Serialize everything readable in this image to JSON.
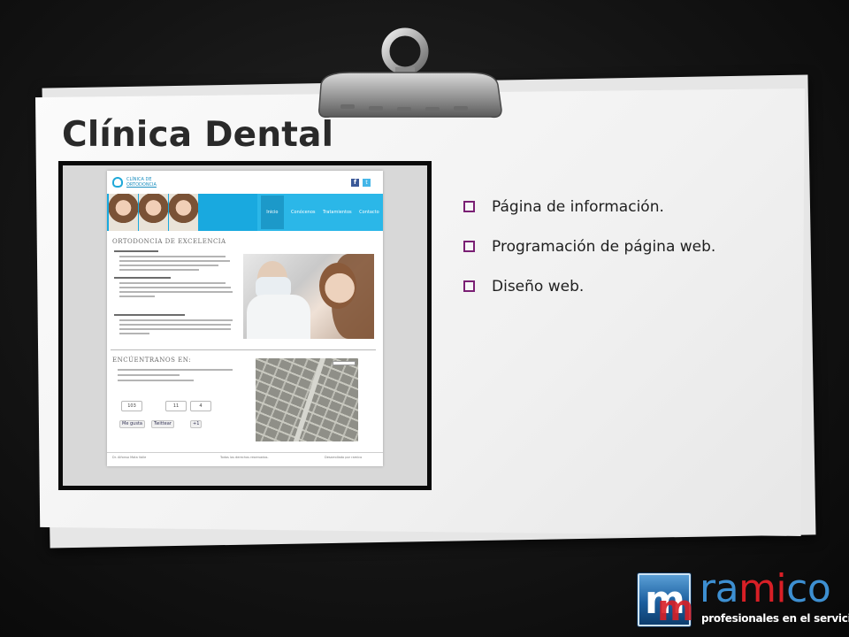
{
  "slide": {
    "title": "Clínica Dental",
    "bullets": [
      "Página de información.",
      "Programación de página web.",
      "Diseño web."
    ]
  },
  "screenshot": {
    "logo_lines": [
      "CLÍNICA DE",
      "ORTODONCIA"
    ],
    "nav": [
      "Inicio",
      "Conócenos",
      "Tratamientos",
      "Contacto"
    ],
    "section_title": "ORTODONCIA DE EXCELENCIA",
    "location_title": "ENCÚENTRANOS EN:",
    "like_count": "103",
    "tweet_count": "11",
    "plus_count": "4",
    "like_label": "Me gusta",
    "tweet_label": "Twittear",
    "plus_label": "+1",
    "footer": [
      "Dr. Alfonso Mata Valle",
      "Todos los derechos reservados.",
      "Desarrollado por ramico"
    ]
  },
  "brand": {
    "word_parts": [
      "ra",
      "mi",
      "co"
    ],
    "tagline": "profesionales en el servicio"
  },
  "colors": {
    "bullet": "#7a1f74",
    "site_banner": "#19a9df",
    "brand_blue": "#3d8fd1",
    "brand_red": "#d81f26"
  },
  "icons": {
    "bullet": "square-bullet-icon",
    "clip": "paper-clip-icon",
    "facebook": "facebook-icon",
    "twitter": "twitter-icon"
  }
}
